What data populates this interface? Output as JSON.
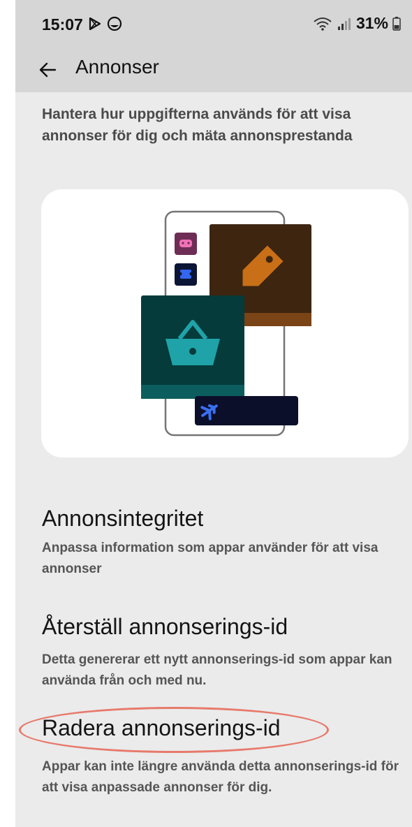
{
  "status_bar": {
    "time": "15:07",
    "battery": "31%",
    "left_icons": [
      "play-store-notification-icon",
      "chat-notification-icon"
    ],
    "right_icons": [
      "wifi-icon",
      "signal-icon",
      "battery-icon"
    ]
  },
  "app_bar": {
    "back_icon": "arrow-left-icon",
    "title": "Annonser"
  },
  "intro": "Hantera hur uppgifterna används för att visa annonser för dig och mäta annonsprestanda",
  "illustration": {
    "icons": [
      "gamepad-icon",
      "ticket-icon",
      "price-tag-icon",
      "shopping-basket-icon",
      "airplane-icon"
    ]
  },
  "sections": [
    {
      "title": "Annonsintegritet",
      "description": "Anpassa information som appar använder för att visa annonser"
    },
    {
      "title": "Återställ annonserings-id",
      "description": "Detta genererar ett nytt annonserings-id som appar kan använda från och med nu."
    },
    {
      "title": "Radera annonserings-id",
      "description": "Appar kan inte längre använda detta annonserings-id för att visa anpassade annonser för dig."
    }
  ],
  "colors": {
    "background": "#ebebeb",
    "header": "#d6d6d6",
    "highlight": "#e77a6c",
    "tag_card": "#3d2510",
    "basket_card": "#053b3b",
    "plane_card": "#0b0f2a"
  }
}
